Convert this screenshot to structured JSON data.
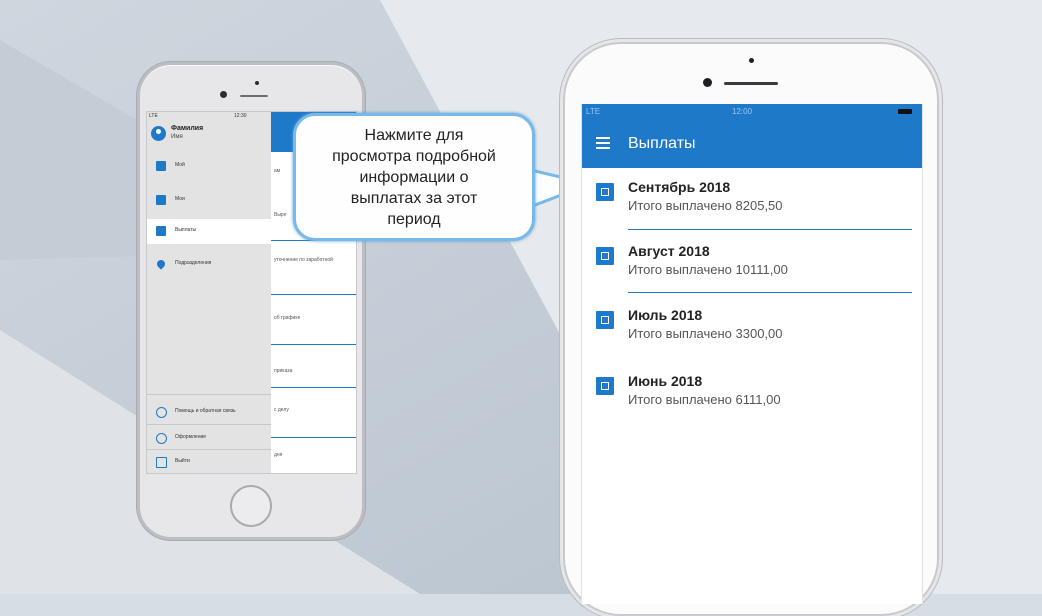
{
  "colors": {
    "accent": "#1f79c9",
    "callout_border": "#76b9ea",
    "background": "#d7dde4"
  },
  "left_phone": {
    "status": {
      "signal": "LTE",
      "time": "12:30"
    },
    "drawer": {
      "user_name": "Фамилия",
      "user_sub": "Имя",
      "items": [
        {
          "label": "Мой",
          "icon": "calendar-icon"
        },
        {
          "label": "Мои",
          "icon": "briefcase-icon"
        },
        {
          "label": "Выплаты",
          "icon": "wallet-icon",
          "active": true
        },
        {
          "label": "Подразделения",
          "icon": "location-pin-icon"
        }
      ],
      "bottom_items": [
        {
          "label": "Помощь и обратная связь",
          "icon": "help-icon"
        },
        {
          "label": "Оформление",
          "icon": "info-icon"
        },
        {
          "label": "Выйти",
          "icon": "logout-icon"
        }
      ]
    },
    "peek_rows": [
      "ам",
      "Выре",
      "уточнение по заработной",
      "об графике",
      "приказа",
      "с делу",
      "дня"
    ]
  },
  "callout": {
    "text": "Нажмите для\nпросмотра подробной\nинформации о\nвыплатах за этот\nпериод"
  },
  "right_phone": {
    "status": {
      "signal": "LTE",
      "time": "12:00"
    },
    "appbar": {
      "title": "Выплаты",
      "menu_icon": "hamburger-menu-icon"
    },
    "payments": [
      {
        "title": "Сентябрь 2018",
        "sub": "Итого выплачено 8205,50",
        "icon": "wallet-icon"
      },
      {
        "title": "Август 2018",
        "sub": "Итого выплачено 10111,00",
        "icon": "wallet-icon"
      },
      {
        "title": "Июль 2018",
        "sub": "Итого выплачено 3300,00",
        "icon": "wallet-icon"
      },
      {
        "title": "Июнь 2018",
        "sub": "Итого выплачено 6111,00",
        "icon": "wallet-icon"
      }
    ]
  }
}
